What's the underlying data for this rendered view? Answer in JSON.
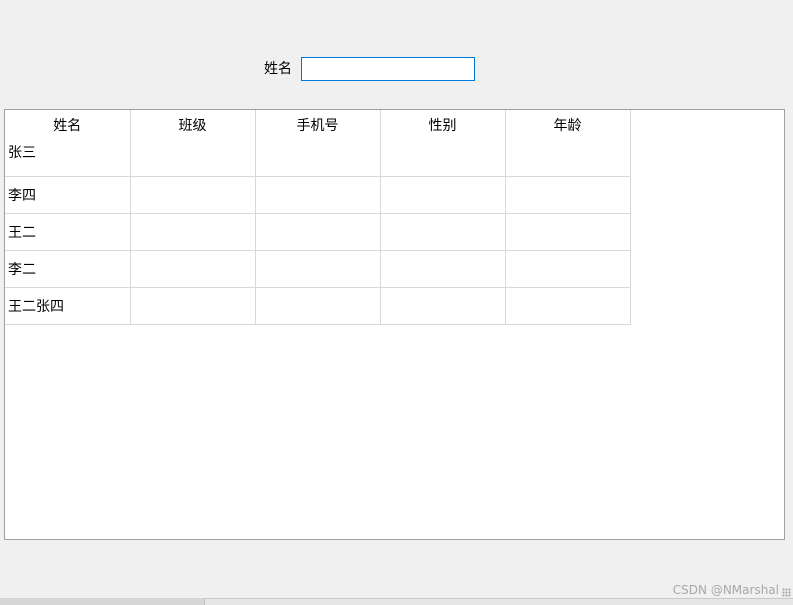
{
  "search": {
    "label": "姓名",
    "value": "",
    "placeholder": ""
  },
  "table": {
    "columns": [
      "姓名",
      "班级",
      "手机号",
      "性别",
      "年龄"
    ],
    "rows": [
      [
        "张三",
        "",
        "",
        "",
        ""
      ],
      [
        "李四",
        "",
        "",
        "",
        ""
      ],
      [
        "王二",
        "",
        "",
        "",
        ""
      ],
      [
        "李二",
        "",
        "",
        "",
        ""
      ],
      [
        "王二张四",
        "",
        "",
        "",
        ""
      ]
    ]
  },
  "watermark": "CSDN @NMarshal",
  "colors": {
    "window_bg": "#f0f0f0",
    "input_border": "#0078d7",
    "grid_line": "#d8d8d8",
    "panel_border": "#a0a0a0"
  }
}
